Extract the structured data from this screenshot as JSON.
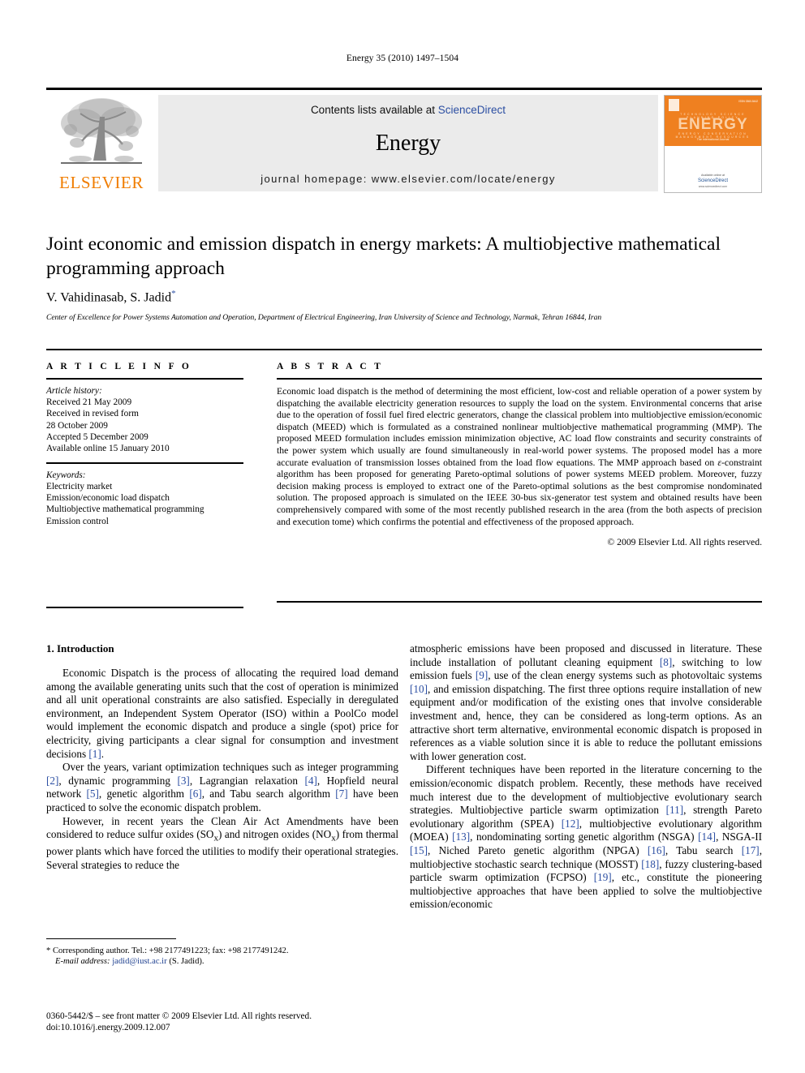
{
  "running_head": "Energy 35 (2010) 1497–1504",
  "masthead": {
    "publisher_name": "ELSEVIER",
    "contents_prefix": "Contents lists available at ",
    "sciencedirect": "ScienceDirect",
    "journal_name": "Energy",
    "homepage": "journal homepage: www.elsevier.com/locate/energy",
    "cover": {
      "title": "ENERGY",
      "subtitle": "The international Journal",
      "row_top": "TECHNOLOGY   SCIENCE   PLANNING   POLICY",
      "row_bottom": "ENERGY   CONSERVATION   MANAGEMENT   RESOURCES",
      "corner_label": "ISSN 0360-5442",
      "avail_label": "Available online at",
      "sd_label": "ScienceDirect",
      "sd_url": "www.sciencedirect.com"
    }
  },
  "article": {
    "title": "Joint economic and emission dispatch in energy markets: A multiobjective mathematical programming approach",
    "authors": "V. Vahidinasab, S. Jadid",
    "author_marker": "*",
    "affiliation": "Center of Excellence for Power Systems Automation and Operation, Department of Electrical Engineering, Iran University of Science and Technology, Narmak, Tehran 16844, Iran"
  },
  "info": {
    "heading": "A R T I C L E   I N F O",
    "history_label": "Article history:",
    "history": [
      "Received 21 May 2009",
      "Received in revised form",
      "28 October 2009",
      "Accepted 5 December 2009",
      "Available online 15 January 2010"
    ],
    "keywords_label": "Keywords:",
    "keywords": [
      "Electricity market",
      "Emission/economic load dispatch",
      "Multiobjective mathematical programming",
      "Emission control"
    ]
  },
  "abstract": {
    "heading": "A B S T R A C T",
    "text": "Economic load dispatch is the method of determining the most efficient, low-cost and reliable operation of a power system by dispatching the available electricity generation resources to supply the load on the system. Environmental concerns that arise due to the operation of fossil fuel fired electric generators, change the classical problem into multiobjective emission/economic dispatch (MEED) which is formulated as a constrained nonlinear multiobjective mathematical programming (MMP). The proposed MEED formulation includes emission minimization objective, AC load flow constraints and security constraints of the power system which usually are found simultaneously in real-world power systems. The proposed model has a more accurate evaluation of transmission losses obtained from the load flow equations. The MMP approach based on ε-constraint algorithm has been proposed for generating Pareto-optimal solutions of power systems MEED problem. Moreover, fuzzy decision making process is employed to extract one of the Pareto-optimal solutions as the best compromise nondominated solution. The proposed approach is simulated on the IEEE 30-bus six-generator test system and obtained results have been comprehensively compared with some of the most recently published research in the area (from the both aspects of precision and execution tome) which confirms the potential and effectiveness of the proposed approach.",
    "copyright": "© 2009 Elsevier Ltd. All rights reserved."
  },
  "intro": {
    "heading": "1. Introduction",
    "left_paragraphs": [
      "Economic Dispatch is the process of allocating the required load demand among the available generating units such that the cost of operation is minimized and all unit operational constraints are also satisfied. Especially in deregulated environment, an Independent System Operator (ISO) within a PoolCo model would implement the economic dispatch and produce a single (spot) price for electricity, giving participants a clear signal for consumption and investment decisions [1].",
      "Over the years, variant optimization techniques such as integer programming [2], dynamic programming [3], Lagrangian relaxation [4], Hopfield neural network [5], genetic algorithm [6], and Tabu search algorithm [7] have been practiced to solve the economic dispatch problem.",
      "However, in recent years the Clean Air Act Amendments have been considered to reduce sulfur oxides (SOx) and nitrogen oxides (NOx) from thermal power plants which have forced the utilities to modify their operational strategies. Several strategies to reduce the"
    ],
    "right_paragraphs": [
      "atmospheric emissions have been proposed and discussed in literature. These include installation of pollutant cleaning equipment [8], switching to low emission fuels [9], use of the clean energy systems such as photovoltaic systems [10], and emission dispatching. The first three options require installation of new equipment and/or modification of the existing ones that involve considerable investment and, hence, they can be considered as long-term options. As an attractive short term alternative, environmental economic dispatch is proposed in references as a viable solution since it is able to reduce the pollutant emissions with lower generation cost.",
      "Different techniques have been reported in the literature concerning to the emission/economic dispatch problem. Recently, these methods have received much interest due to the development of multiobjective evolutionary search strategies. Multiobjective particle swarm optimization [11], strength Pareto evolutionary algorithm (SPEA) [12], multiobjective evolutionary algorithm (MOEA) [13], nondominating sorting genetic algorithm (NSGA) [14], NSGA-II [15], Niched Pareto genetic algorithm (NPGA) [16], Tabu search [17], multiobjective stochastic search technique (MOSST) [18], fuzzy clustering-based particle swarm optimization (FCPSO) [19], etc., constitute the pioneering multiobjective approaches that have been applied to solve the multiobjective emission/economic"
    ]
  },
  "footnote": {
    "corresponding": "* Corresponding author. Tel.: +98 2177491223; fax: +98 2177491242.",
    "email_label": "E-mail address:",
    "email": "jadid@iust.ac.ir",
    "email_suffix": "(S. Jadid)."
  },
  "imprint": {
    "line1": "0360-5442/$ – see front matter © 2009 Elsevier Ltd. All rights reserved.",
    "line2": "doi:10.1016/j.energy.2009.12.007"
  },
  "colors": {
    "elsevier_orange": "#F07D00",
    "link_blue": "#2b4ea2",
    "banner_gray": "#ebebeb",
    "cover_orange": "#ef8020"
  }
}
